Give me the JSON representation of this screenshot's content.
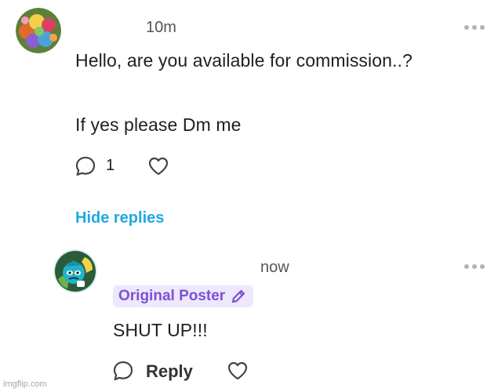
{
  "comment": {
    "time": "10m",
    "text_line1": "Hello, are you available for commission..?",
    "text_line2": "If yes please Dm me",
    "reply_count": "1"
  },
  "hide_replies_label": "Hide replies",
  "reply": {
    "time": "now",
    "badge_label": "Original Poster",
    "text": "SHUT UP!!!",
    "reply_label": "Reply"
  },
  "watermark": "imgflip.com",
  "colors": {
    "accent_blue": "#1fa9e0",
    "op_purple": "#7a52d6",
    "op_badge_bg": "#ede8fb",
    "icon_gray": "#444444",
    "menu_dots": "#b3b3b3"
  },
  "icons": [
    "more-menu-icon",
    "comment-bubble-icon",
    "heart-icon",
    "pencil-icon"
  ]
}
